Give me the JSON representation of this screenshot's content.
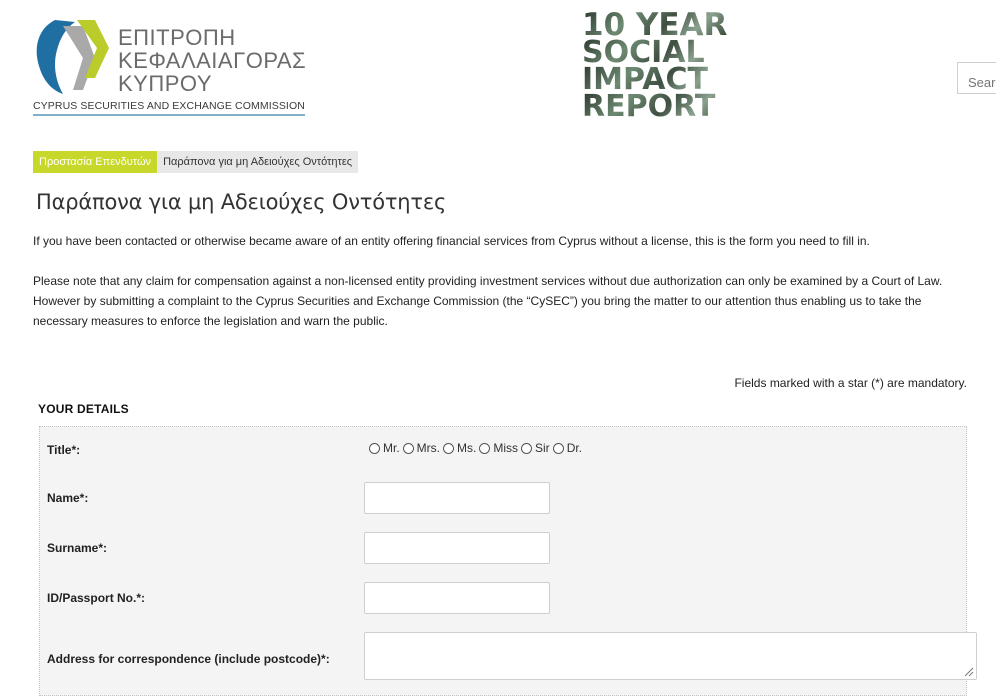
{
  "header": {
    "logo_lines": [
      "ΕΠΙΤΡΟΠΗ",
      "ΚΕΦΑΛΑΙΑΓΟΡΑΣ",
      "ΚΥΠΡΟΥ"
    ],
    "logo_subtitle": "CYPRUS SECURITIES AND EXCHANGE COMMISSION",
    "banner_lines": [
      "10 YEAR",
      "SOCIAL",
      "IMPACT",
      "REPORT"
    ],
    "search_placeholder": "Search",
    "colors": {
      "logo_blue": "#1f6fa3",
      "logo_green": "#b9cc2a",
      "logo_grey": "#a9a9a9"
    }
  },
  "breadcrumb": {
    "items": [
      "Προστασία Επενδυτών",
      "Παράπονα για μη Αδειούχες Οντότητες"
    ],
    "active_color": "#c8d82a"
  },
  "page": {
    "title": "Παράπονα για μη Αδειούχες Οντότητες",
    "intro": "If you have been contacted or otherwise became aware of an entity offering financial services from Cyprus without a license, this is the form you need to fill in.",
    "note": "Please note that any claim for compensation against a non-licensed entity providing investment services without due authorization can only be examined by a Court of Law. However by submitting a complaint to the Cyprus Securities and Exchange Commission (the “CySEC”) you bring the matter to our attention thus enabling us to take the necessary measures to enforce the legislation and warn the public."
  },
  "form": {
    "mandatory_note": "Fields marked with a star (*) are mandatory.",
    "section_heading": "YOUR DETAILS",
    "labels": {
      "title": "Title*:",
      "name": "Name*:",
      "surname": "Surname*:",
      "id": "ID/Passport No.*:",
      "address": "Address for correspondence (include postcode)*:"
    },
    "title_options": [
      "Mr.",
      "Mrs.",
      "Ms.",
      "Miss",
      "Sir",
      "Dr."
    ],
    "values": {
      "name": "",
      "surname": "",
      "id": "",
      "address": ""
    }
  }
}
